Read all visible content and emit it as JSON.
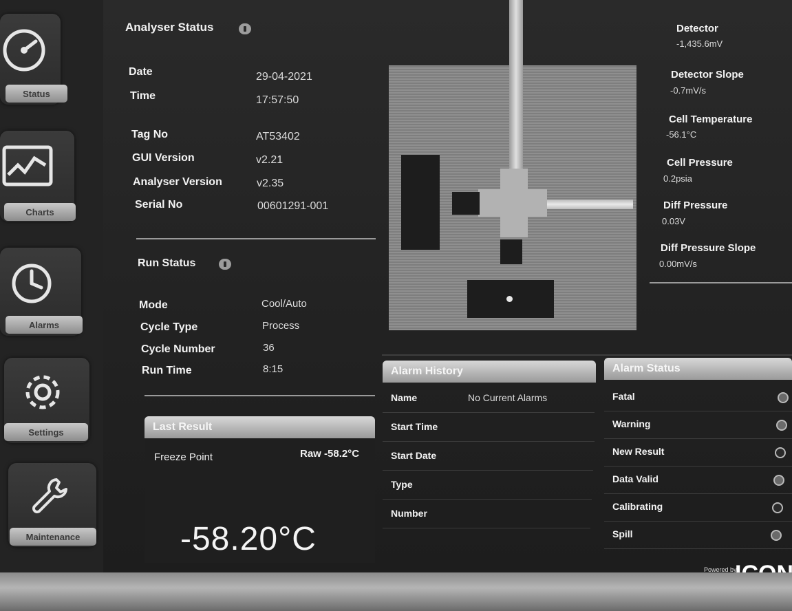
{
  "sidebar": {
    "items": [
      {
        "label": "Status",
        "icon": "gauge-icon"
      },
      {
        "label": "Charts",
        "icon": "chart-icon"
      },
      {
        "label": "Alarms",
        "icon": "clock-icon"
      },
      {
        "label": "Settings",
        "icon": "gear-icon"
      },
      {
        "label": "Maintenance",
        "icon": "wrench-icon"
      }
    ]
  },
  "analyser_status": {
    "title": "Analyser Status",
    "date_label": "Date",
    "date_value": "29-04-2021",
    "time_label": "Time",
    "time_value": "17:57:50",
    "tag_label": "Tag No",
    "tag_value": "AT53402",
    "gui_label": "GUI Version",
    "gui_value": "v2.21",
    "analyser_label": "Analyser Version",
    "analyser_value": "v2.35",
    "serial_label": "Serial No",
    "serial_value": "00601291-001"
  },
  "run_status": {
    "title": "Run Status",
    "mode_label": "Mode",
    "mode_value": "Cool/Auto",
    "cycle_type_label": "Cycle Type",
    "cycle_type_value": "Process",
    "cycle_number_label": "Cycle Number",
    "cycle_number_value": "36",
    "run_time_label": "Run Time",
    "run_time_value": "8:15"
  },
  "last_result": {
    "title": "Last Result",
    "freeze_label": "Freeze Point",
    "raw_value": "Raw -58.2°C",
    "big_value": "-58.20°C"
  },
  "readings": [
    {
      "label": "Detector",
      "value": "-1,435.6mV"
    },
    {
      "label": "Detector Slope",
      "value": "-0.7mV/s"
    },
    {
      "label": "Cell Temperature",
      "value": "-56.1°C"
    },
    {
      "label": "Cell Pressure",
      "value": "0.2psia"
    },
    {
      "label": "Diff Pressure",
      "value": "0.03V"
    },
    {
      "label": "Diff Pressure Slope",
      "value": "0.00mV/s"
    }
  ],
  "alarm_history": {
    "title": "Alarm History",
    "rows": [
      {
        "label": "Name",
        "value": "No Current Alarms"
      },
      {
        "label": "Start Time",
        "value": ""
      },
      {
        "label": "Start Date",
        "value": ""
      },
      {
        "label": "Type",
        "value": ""
      },
      {
        "label": "Number",
        "value": ""
      }
    ]
  },
  "alarm_status": {
    "title": "Alarm Status",
    "rows": [
      {
        "label": "Fatal"
      },
      {
        "label": "Warning"
      },
      {
        "label": "New Result"
      },
      {
        "label": "Data Valid"
      },
      {
        "label": "Calibrating"
      },
      {
        "label": "Spill"
      }
    ]
  },
  "branding": {
    "powered_by": "Powered by",
    "logo": "ICON"
  }
}
